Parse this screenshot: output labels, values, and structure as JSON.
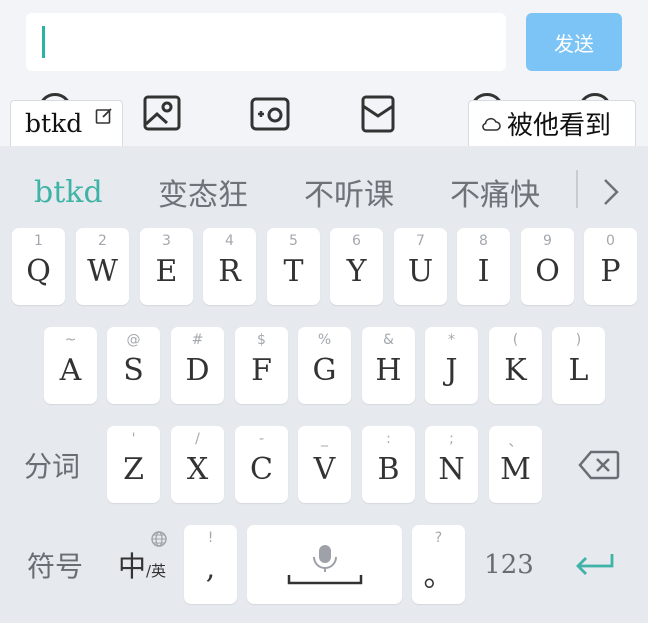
{
  "input": {
    "value": ""
  },
  "send_label": "发送",
  "toolbar": {
    "icons": [
      "image-edit-icon",
      "camera-plus-icon",
      "envelope-icon"
    ]
  },
  "chips": {
    "left_text": "btkd",
    "right_text": "被他看到"
  },
  "candidates": [
    "btkd",
    "变态狂",
    "不听课",
    "不痛快"
  ],
  "keyboard": {
    "rows": [
      [
        {
          "hint": "1",
          "key": "Q"
        },
        {
          "hint": "2",
          "key": "W"
        },
        {
          "hint": "3",
          "key": "E"
        },
        {
          "hint": "4",
          "key": "R"
        },
        {
          "hint": "5",
          "key": "T"
        },
        {
          "hint": "6",
          "key": "Y"
        },
        {
          "hint": "7",
          "key": "U"
        },
        {
          "hint": "8",
          "key": "I"
        },
        {
          "hint": "9",
          "key": "O"
        },
        {
          "hint": "0",
          "key": "P"
        }
      ],
      [
        {
          "hint": "~",
          "key": "A"
        },
        {
          "hint": "@",
          "key": "S"
        },
        {
          "hint": "#",
          "key": "D"
        },
        {
          "hint": "$",
          "key": "F"
        },
        {
          "hint": "%",
          "key": "G"
        },
        {
          "hint": "&",
          "key": "H"
        },
        {
          "hint": "*",
          "key": "J"
        },
        {
          "hint": "(",
          "key": "K"
        },
        {
          "hint": ")",
          "key": "L"
        }
      ],
      [
        {
          "hint": "'",
          "key": "Z"
        },
        {
          "hint": "/",
          "key": "X"
        },
        {
          "hint": "-",
          "key": "C"
        },
        {
          "hint": "_",
          "key": "V"
        },
        {
          "hint": ":",
          "key": "B"
        },
        {
          "hint": ";",
          "key": "N"
        },
        {
          "hint": "、",
          "key": "M"
        }
      ]
    ],
    "segment_label": "分词",
    "symbols_label": "符号",
    "lang_main": "中",
    "lang_alt": "/英",
    "comma_hint": "!",
    "comma_key": ",",
    "period_hint": "?",
    "period_key": "。",
    "numbers_label": "123"
  },
  "colors": {
    "accent": "#3fb3a6",
    "send_button": "#7cc3f6",
    "keyboard_bg": "#e6e9ee"
  }
}
